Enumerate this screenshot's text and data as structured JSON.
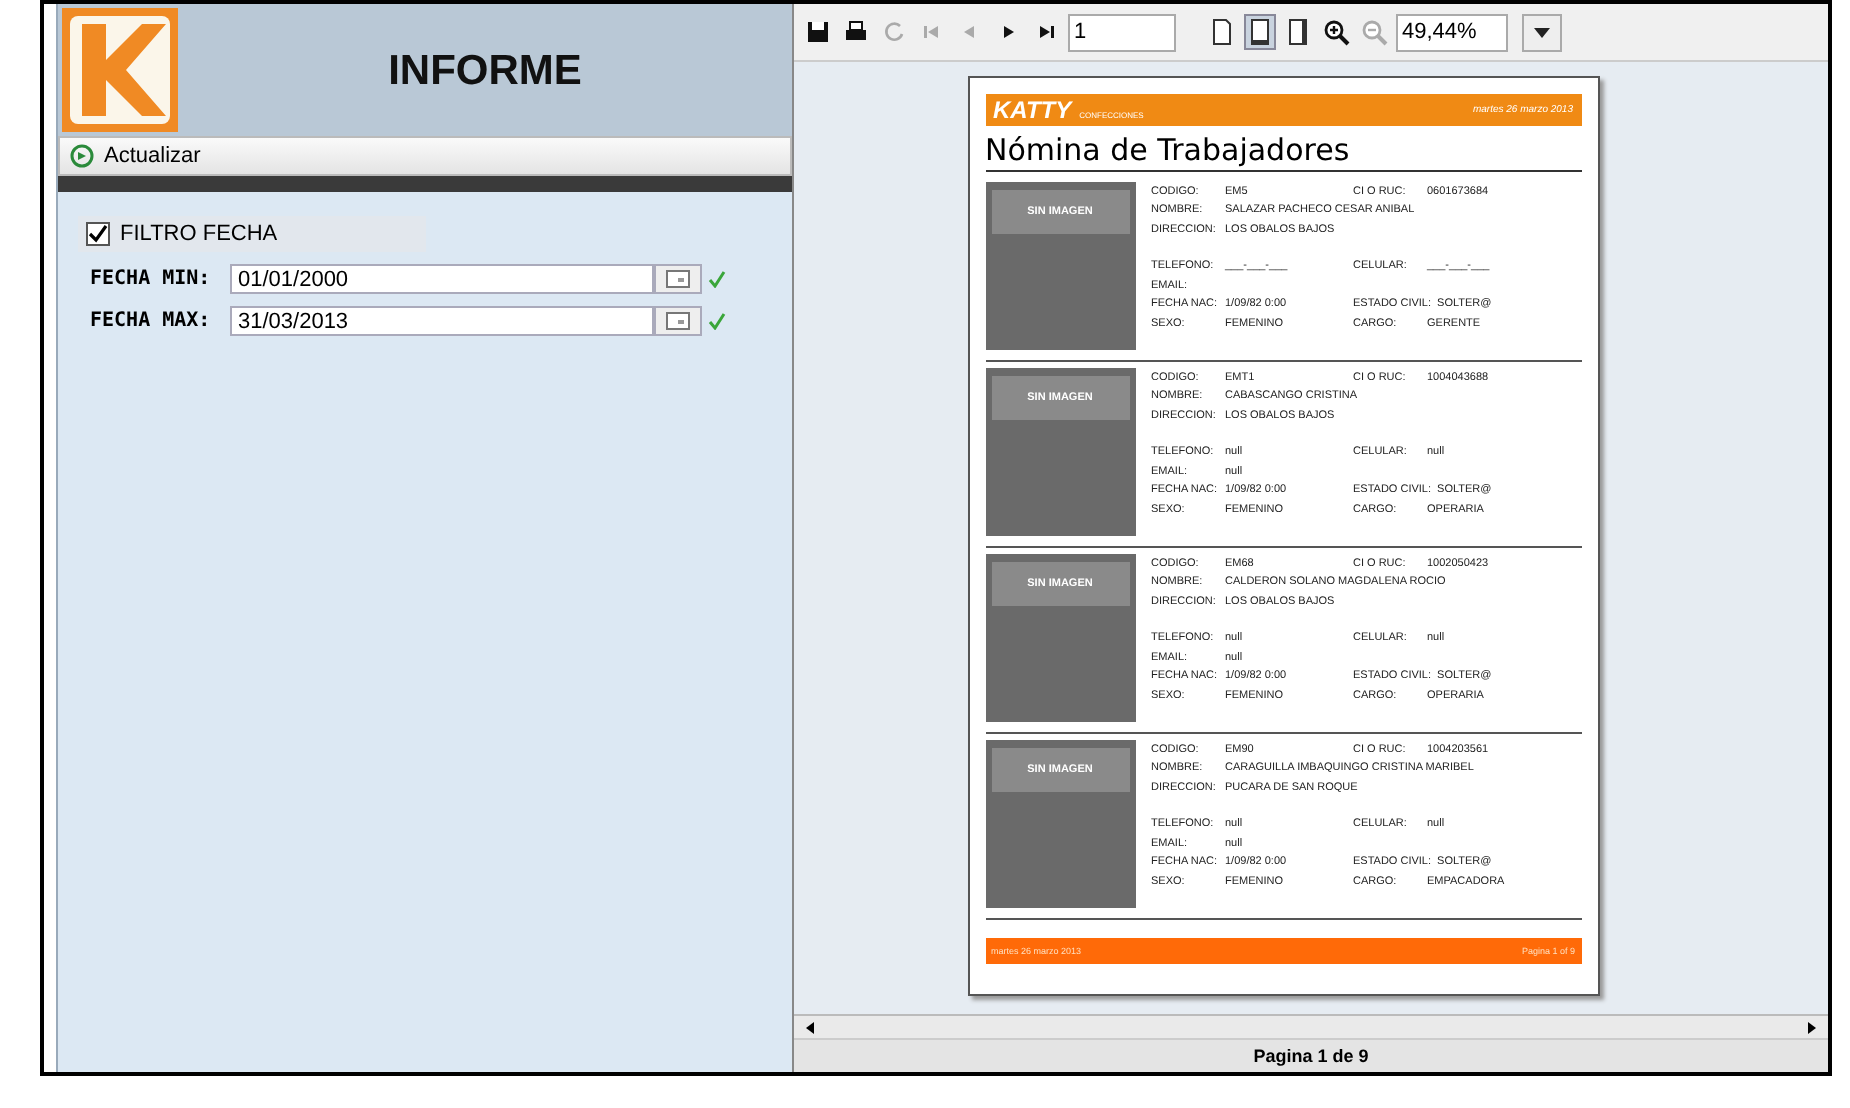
{
  "header": {
    "title": "INFORME"
  },
  "refresh_button": {
    "label": "Actualizar"
  },
  "filter": {
    "label": "FILTRO FECHA",
    "checked": true
  },
  "date_fields": [
    {
      "label": "FECHA MIN:",
      "value": "01/01/2000",
      "valid": true
    },
    {
      "label": "FECHA MAX:",
      "value": "31/03/2013",
      "valid": true
    }
  ],
  "toolbar": [
    {
      "kind": "save",
      "disabled": false
    },
    {
      "kind": "print",
      "disabled": false
    },
    {
      "kind": "reload",
      "disabled": true
    },
    {
      "kind": "first",
      "disabled": true
    },
    {
      "kind": "prev",
      "disabled": true
    },
    {
      "kind": "next",
      "disabled": false
    },
    {
      "kind": "last",
      "disabled": false
    }
  ],
  "page_field": {
    "value": "1"
  },
  "view_modes": [
    {
      "kind": "actual",
      "selected": false
    },
    {
      "kind": "fit-width",
      "selected": true
    },
    {
      "kind": "fit-page",
      "selected": false
    }
  ],
  "zoom_buttons": [
    {
      "kind": "zoom-in",
      "disabled": false
    },
    {
      "kind": "zoom-out",
      "disabled": true
    }
  ],
  "zoom_field": {
    "value": "49,44%"
  },
  "report": {
    "brand": "KATTY",
    "brand_sub": "CONFECCIONES",
    "date": "martes 26 marzo 2013",
    "title": "Nómina de Trabajadores",
    "records": [
      {
        "photo": "SIN IMAGEN",
        "lines": [
          [
            {
              "label": "CODIGO:",
              "value": "EM5"
            },
            {
              "label": "CI O RUC:",
              "value": "0601673684"
            }
          ],
          [
            {
              "label": "NOMBRE:",
              "value": "SALAZAR PACHECO CESAR ANIBAL"
            }
          ],
          [
            {
              "label": "DIRECCION:",
              "value": "LOS OBALOS BAJOS"
            }
          ],
          [
            {
              "label": "TELEFONO:",
              "value": "___-___-___"
            },
            {
              "label": "CELULAR:",
              "value": "___-___-___"
            }
          ],
          [
            {
              "label": "EMAIL:"
            }
          ],
          [
            {
              "label": "FECHA NAC:",
              "value": "1/09/82 0:00"
            },
            {
              "label": "ESTADO CIVIL:",
              "value": "SOLTER@"
            }
          ],
          [
            {
              "label": "SEXO:",
              "value": "FEMENINO"
            },
            {
              "label": "CARGO:",
              "value": "GERENTE"
            }
          ]
        ]
      },
      {
        "photo": "SIN IMAGEN",
        "lines": [
          [
            {
              "label": "CODIGO:",
              "value": "EMT1"
            },
            {
              "label": "CI O RUC:",
              "value": "1004043688"
            }
          ],
          [
            {
              "label": "NOMBRE:",
              "value": "CABASCANGO CRISTINA"
            }
          ],
          [
            {
              "label": "DIRECCION:",
              "value": "LOS OBALOS BAJOS"
            }
          ],
          [
            {
              "label": "TELEFONO:",
              "value": "null"
            },
            {
              "label": "CELULAR:",
              "value": "null"
            }
          ],
          [
            {
              "label": "EMAIL:",
              "value": "null"
            }
          ],
          [
            {
              "label": "FECHA NAC:",
              "value": "1/09/82 0:00"
            },
            {
              "label": "ESTADO CIVIL:",
              "value": "SOLTER@"
            }
          ],
          [
            {
              "label": "SEXO:",
              "value": "FEMENINO"
            },
            {
              "label": "CARGO:",
              "value": "OPERARIA"
            }
          ]
        ]
      },
      {
        "photo": "SIN IMAGEN",
        "lines": [
          [
            {
              "label": "CODIGO:",
              "value": "EM68"
            },
            {
              "label": "CI O RUC:",
              "value": "1002050423"
            }
          ],
          [
            {
              "label": "NOMBRE:",
              "value": "CALDERON SOLANO MAGDALENA ROCIO"
            }
          ],
          [
            {
              "label": "DIRECCION:",
              "value": "LOS OBALOS BAJOS"
            }
          ],
          [
            {
              "label": "TELEFONO:",
              "value": "null"
            },
            {
              "label": "CELULAR:",
              "value": "null"
            }
          ],
          [
            {
              "label": "EMAIL:",
              "value": "null"
            }
          ],
          [
            {
              "label": "FECHA NAC:",
              "value": "1/09/82 0:00"
            },
            {
              "label": "ESTADO CIVIL:",
              "value": "SOLTER@"
            }
          ],
          [
            {
              "label": "SEXO:",
              "value": "FEMENINO"
            },
            {
              "label": "CARGO:",
              "value": "OPERARIA"
            }
          ]
        ]
      },
      {
        "photo": "SIN IMAGEN",
        "lines": [
          [
            {
              "label": "CODIGO:",
              "value": "EM90"
            },
            {
              "label": "CI O RUC:",
              "value": "1004203561"
            }
          ],
          [
            {
              "label": "NOMBRE:",
              "value": "CARAGUILLA IMBAQUINGO CRISTINA MARIBEL"
            }
          ],
          [
            {
              "label": "DIRECCION:",
              "value": "PUCARA DE SAN ROQUE"
            }
          ],
          [
            {
              "label": "TELEFONO:",
              "value": "null"
            },
            {
              "label": "CELULAR:",
              "value": "null"
            }
          ],
          [
            {
              "label": "EMAIL:",
              "value": "null"
            }
          ],
          [
            {
              "label": "FECHA NAC:",
              "value": "1/09/82 0:00"
            },
            {
              "label": "ESTADO CIVIL:",
              "value": "SOLTER@"
            }
          ],
          [
            {
              "label": "SEXO:",
              "value": "FEMENINO"
            },
            {
              "label": "CARGO:",
              "value": "EMPACADORA"
            }
          ]
        ]
      }
    ],
    "footer_left": "martes 26 marzo 2013",
    "footer_right": "Pagina 1 of 9"
  },
  "status": "Pagina 1 de 9"
}
